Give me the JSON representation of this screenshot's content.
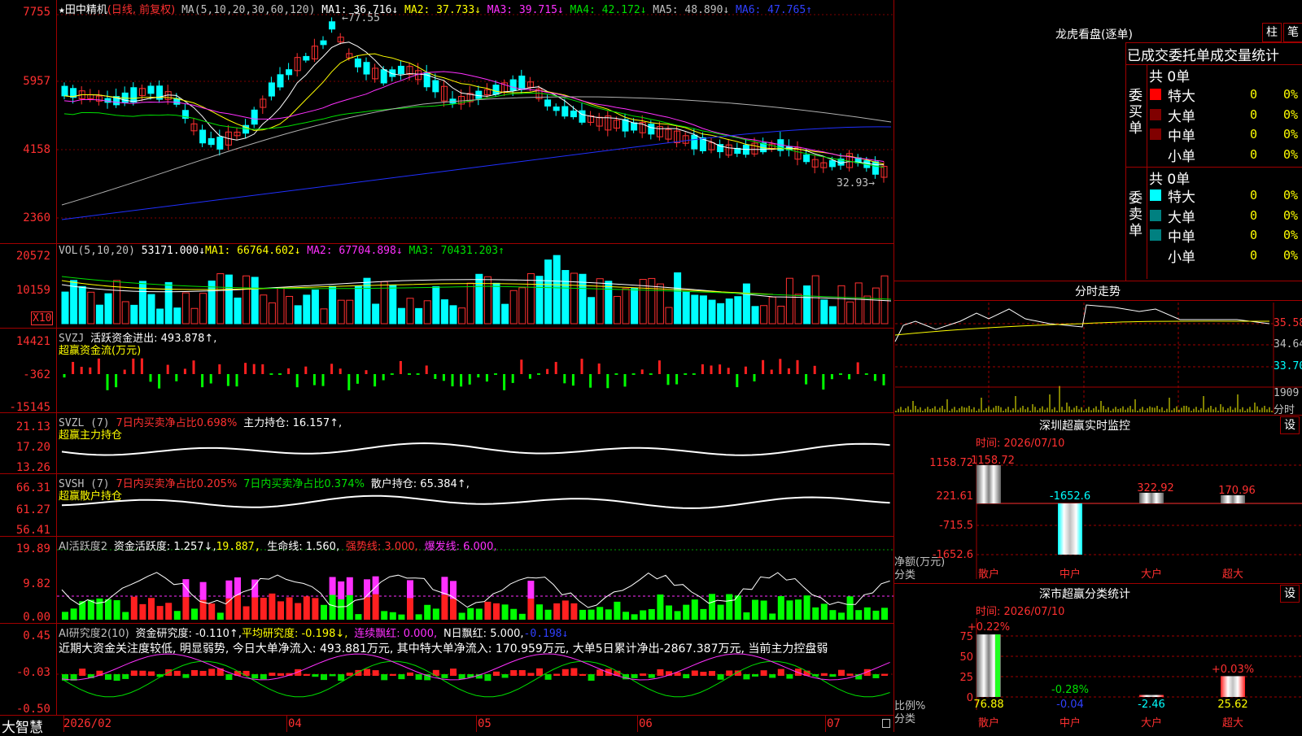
{
  "main_chart": {
    "title_star": "★",
    "stock_name": "田中精机",
    "period_mode": "(日线, 前复权)",
    "ma_label": "MA(5,10,20,30,60,120)",
    "ma1": "MA1: 36.716↓",
    "ma2": "MA2: 37.733↓",
    "ma3": "MA3: 39.715↓",
    "ma4": "MA4: 42.172↓",
    "ma5": "MA5: 48.890↓",
    "ma6": "MA6: 47.765↑",
    "high_marker": "←77.55",
    "low_marker": "32.93→",
    "y_ticks": [
      "7755",
      "5957",
      "4158",
      "2360"
    ]
  },
  "vol_panel": {
    "label": "VOL(5,10,20)",
    "value": "53171.000↓",
    "ma1": "MA1: 66764.602↓",
    "ma2": "MA2: 67704.898↓",
    "ma3": "MA3: 70431.203↑",
    "y_ticks": [
      "20572",
      "10159"
    ],
    "unit_badge": "X10"
  },
  "svzj_panel": {
    "label": "SVZJ",
    "title1": "活跃资金进出: 493.878↑,",
    "title2": "超赢资金流(万元)",
    "y_ticks": [
      "14421",
      "-362",
      "-15145"
    ]
  },
  "svzl_panel": {
    "label": "SVZL (7)",
    "net_ratio": "7日内买卖净占比0.698%",
    "holding": "主力持仓: 16.157↑,",
    "title2": "超赢主力持仓",
    "y_ticks": [
      "21.13",
      "17.20",
      "13.26"
    ]
  },
  "svsh_panel": {
    "label": "SVSH (7)",
    "net_ratio1": "7日内买卖净占比0.205%",
    "net_ratio2": "7日内买卖净占比0.374%",
    "holding": "散户持仓: 65.384↑,",
    "title2": "超赢散户持仓",
    "y_ticks": [
      "66.31",
      "61.27",
      "56.41"
    ]
  },
  "ai_active_panel": {
    "label": "AI活跃度2",
    "activity": "资金活跃度: 1.257↓,",
    "v2": "19.887,",
    "life_line": "生命线: 1.560,",
    "strong_line": "强势线: 3.000,",
    "burst_line": "爆发线: 6.000,",
    "y_ticks": [
      "19.89",
      "9.82",
      "0.00"
    ]
  },
  "ai_research_panel": {
    "label": "AI研究度2(10)",
    "research": "资金研究度: -0.110↑,",
    "avg_research": "平均研究度: -0.198↓,",
    "streak_red": "连续飘红: 0.000,",
    "n_red": "N日飘红: 5.000,",
    "tail": "-0.198↓",
    "summary": "近期大资金关注度较低, 明显弱势, 今日大单净流入: 493.881万元, 其中特大单净流入: 170.959万元, 大单5日累计净出-2867.387万元, 当前主力控盘弱",
    "y_ticks": [
      "0.45",
      "-0.03",
      "-0.50"
    ]
  },
  "time_axis": {
    "brand": "大智慧",
    "labels": [
      "2026/02",
      "04",
      "05",
      "06",
      "07"
    ]
  },
  "dragon_tiger": {
    "title": "龙虎看盘(逐单)",
    "btn_bar": "柱",
    "btn_deal": "笔",
    "header": "已成交委托单成交量统计",
    "buy_side_label": "委买单",
    "sell_side_label": "委卖单",
    "buy_total": "共 0单",
    "sell_total": "共 0单",
    "buy_rows": [
      {
        "name": "特大",
        "count": "0",
        "pct": "0%",
        "color": "#ff0000"
      },
      {
        "name": "大单",
        "count": "0",
        "pct": "0%",
        "color": "#800000"
      },
      {
        "name": "中单",
        "count": "0",
        "pct": "0%",
        "color": "#800000"
      },
      {
        "name": "小单",
        "count": "0",
        "pct": "0%",
        "color": ""
      }
    ],
    "sell_rows": [
      {
        "name": "特大",
        "count": "0",
        "pct": "0%",
        "color": "#00ffff"
      },
      {
        "name": "大单",
        "count": "0",
        "pct": "0%",
        "color": "#008080"
      },
      {
        "name": "中单",
        "count": "0",
        "pct": "0%",
        "color": "#008080"
      },
      {
        "name": "小单",
        "count": "0",
        "pct": "0%",
        "color": ""
      }
    ]
  },
  "intraday": {
    "title": "分时走势",
    "price_ticks": [
      "35.58",
      "34.64",
      "33.70"
    ],
    "vol_tick": "1909",
    "unit": "分时"
  },
  "sz_monitor": {
    "title": "深圳超赢实时监控",
    "btn": "设",
    "time": "时间: 2026/07/10",
    "y_ticks": [
      "1158.72",
      "221.61",
      "-715.5",
      "-1652.6"
    ],
    "unit_label1": "净额(万元)",
    "unit_label2": "分类",
    "categories": [
      "散户",
      "中户",
      "大户",
      "超大"
    ],
    "values": [
      1158.72,
      -1652.6,
      322.92,
      170.96
    ],
    "value_labels": [
      "1158.72",
      "-1652.6",
      "322.92",
      "170.96"
    ]
  },
  "sz_classify": {
    "title": "深市超赢分类统计",
    "btn": "设",
    "time": "时间: 2026/07/10",
    "y_ticks": [
      "75",
      "50",
      "25",
      "0"
    ],
    "unit_label1": "比例%",
    "unit_label2": "分类",
    "categories": [
      "散户",
      "中户",
      "大户",
      "超大"
    ],
    "top_labels": [
      "+0.22%",
      "-0.28%",
      "",
      "+0.03%"
    ],
    "bottom_values": [
      "76.88",
      "-0.04",
      "-2.46",
      "25.62"
    ],
    "values": [
      76.88,
      0.04,
      2.46,
      25.62
    ]
  },
  "chart_data": [
    {
      "type": "bar",
      "title": "深圳超赢实时监控",
      "categories": [
        "散户",
        "中户",
        "大户",
        "超大"
      ],
      "values": [
        1158.72,
        -1652.6,
        322.92,
        170.96
      ],
      "ylabel": "净额(万元)",
      "ylim": [
        -1652.6,
        1158.72
      ]
    },
    {
      "type": "bar",
      "title": "深市超赢分类统计",
      "categories": [
        "散户",
        "中户",
        "大户",
        "超大"
      ],
      "values": [
        76.88,
        -0.04,
        -2.46,
        25.62
      ],
      "ylabel": "比例%",
      "ylim": [
        0,
        75
      ]
    }
  ]
}
